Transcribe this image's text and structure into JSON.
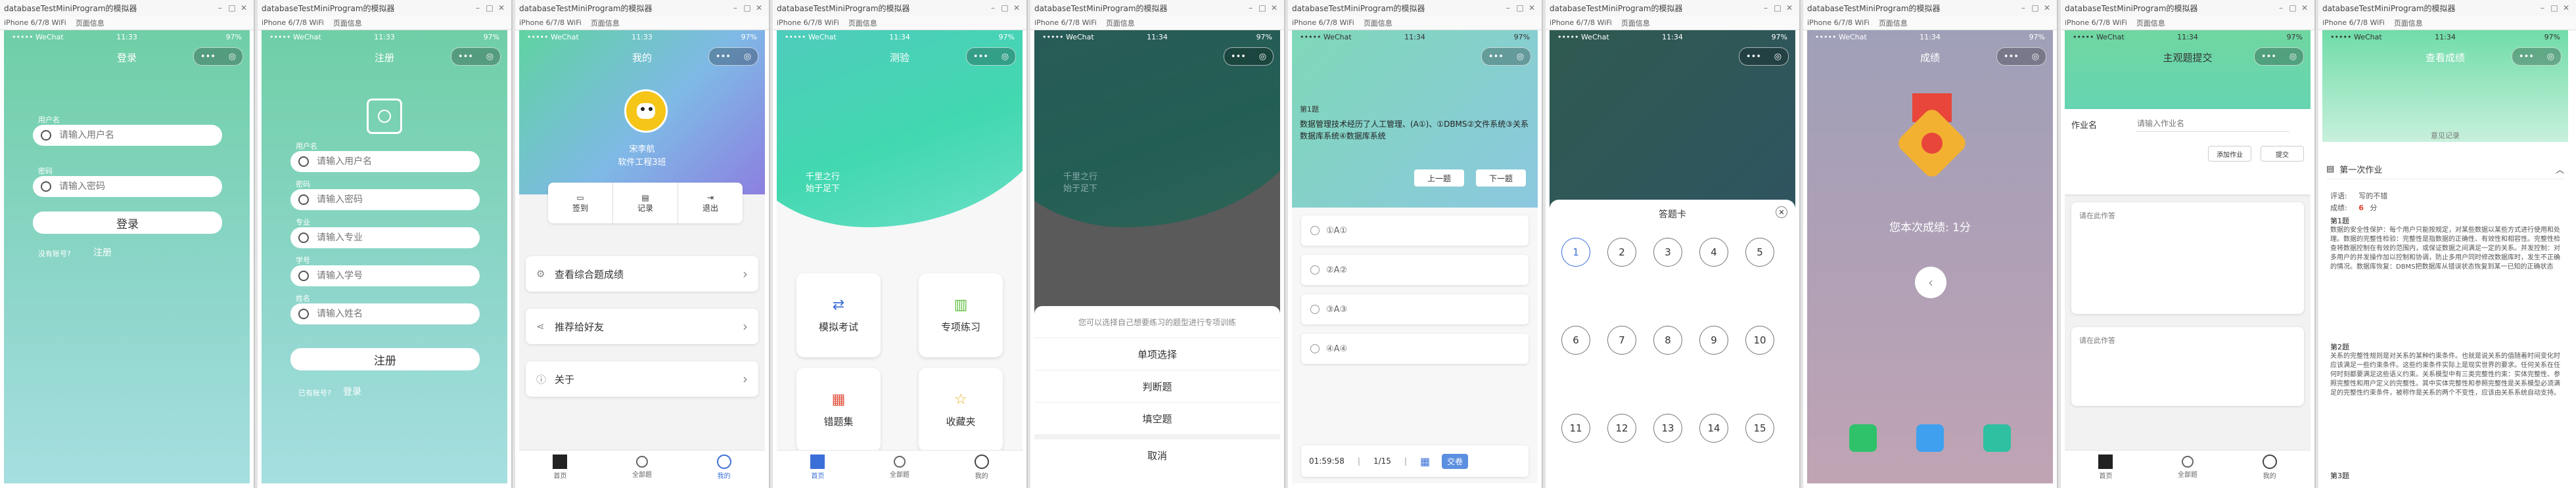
{
  "window": {
    "title": "databaseTestMiniProgram的模拟器",
    "device": "iPhone 6/7/8 WiFi",
    "page_info": "页面信息"
  },
  "status": {
    "carrier": "••••• WeChat",
    "battery": "97%"
  },
  "capsule": {
    "dots": "•••",
    "target": "◎"
  },
  "login": {
    "time": "11:33",
    "title": "登录",
    "username_label": "用户名",
    "username_placeholder": "请输入用户名",
    "password_label": "密码",
    "password_placeholder": "请输入密码",
    "login_button": "登录",
    "no_account": "没有账号?",
    "register_link": "注册"
  },
  "register": {
    "time": "11:33",
    "title": "注册",
    "fields": [
      {
        "label": "用户名",
        "placeholder": "请输入用户名"
      },
      {
        "label": "密码",
        "placeholder": "请输入密码"
      },
      {
        "label": "专业",
        "placeholder": "请输入专业"
      },
      {
        "label": "学号",
        "placeholder": "请输入学号"
      },
      {
        "label": "姓名",
        "placeholder": "请输入姓名"
      }
    ],
    "register_button": "注册",
    "has_account": "已有账号?",
    "login_link": "登录"
  },
  "profile": {
    "time": "11:33",
    "title": "我的",
    "name": "宋李航",
    "major": "软件工程3班",
    "quick": [
      "签到",
      "记录",
      "退出"
    ],
    "menu": [
      "查看综合题成绩",
      "推荐给好友",
      "关于"
    ]
  },
  "tabs": [
    "首页",
    "全部题",
    "我的"
  ],
  "test": {
    "time": "11:34",
    "title": "测验",
    "banner_line1": "千里之行",
    "banner_line2": "始于足下",
    "tiles": [
      "模拟考试",
      "专项练习",
      "错题集",
      "收藏夹"
    ]
  },
  "choose": {
    "time": "11:34",
    "banner_line1": "千里之行",
    "banner_line2": "始于足下",
    "prompt": "您可以选择自己想要练习的题型进行专项训练",
    "options": [
      "单项选择",
      "判断题",
      "填空题"
    ],
    "cancel": "取消"
  },
  "question": {
    "time": "11:34",
    "qnum": "第1题",
    "text": "数据管理技术经历了人工管理、(A①)、①DBMS②文件系统③关系数据库系统④数据库系统",
    "prev": "上一题",
    "next": "下一题",
    "options": [
      "①A①",
      "②A②",
      "③A③",
      "④A④"
    ],
    "timer": "01:59:58",
    "progress": "1/15",
    "submit": "交卷"
  },
  "answer_card": {
    "time": "11:34",
    "title": "答题卡",
    "numbers": [
      "1",
      "2",
      "3",
      "4",
      "5",
      "6",
      "7",
      "8",
      "9",
      "10",
      "11",
      "12",
      "13",
      "14",
      "15"
    ]
  },
  "result": {
    "time": "11:34",
    "title": "成绩",
    "score_text": "您本次成绩: 1分"
  },
  "subjective": {
    "time": "11:34",
    "title": "主观题提交",
    "homework_label": "作业名",
    "homework_placeholder": "请输入作业名",
    "btn1": "添加作业",
    "btn2": "提交",
    "answer_placeholder": "请在此作答",
    "answer_placeholder2": "请在此作答"
  },
  "grades": {
    "time": "11:34",
    "title": "查看成绩",
    "subtitle": "意见记录",
    "section": "第一次作业",
    "comment_label": "评语:",
    "comment": "写的不错",
    "score_label": "成绩:",
    "score": "6",
    "unit": "分",
    "q1": "第1题",
    "q1_text": "数据的安全性保护：每个用户只能按规定，对某些数据以某些方式进行使用和处理。数据的完整性检验：完整性是指数据的正确性、有效性和相容性。完整性检查将数据控制在有效的范围内，或保证数据之间满足一定的关系。并发控制：对多用户的并发操作加以控制和协调，防止多用户同时修改数据库时，发生不正确的情况。数据库恢复：DBMS把数据库从错误状态恢复到某一已知的正确状态",
    "q2": "第2题",
    "q2_text": "关系的完整性规则是对关系的某种约束条件。也就是说关系的值随着时间变化时应该满足一些约束条件。这些约束条件实际上是现实世界的要求。任何关系在任何时刻都要满足这些语义约束。关系模型中有三类完整性约束：实体完整性、参照完整性和用户定义的完整性。其中实体完整性和参照完整性是关系模型必须满足的完整性约束条件，被称作是关系的两个不变性，应该由关系系统自动支持。",
    "q3": "第3题"
  }
}
